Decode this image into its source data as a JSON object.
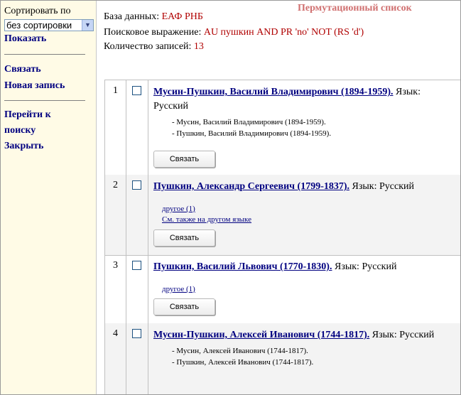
{
  "sidebar": {
    "sort_label": "Сортировать по",
    "sort_selected": "без сортировки",
    "show": "Показать",
    "link": "Связать",
    "new_record": "Новая запись",
    "goto_search_line1": "Перейти к",
    "goto_search_line2": "поиску",
    "close": "Закрыть"
  },
  "header": {
    "title": "Пермутационный список",
    "db_label": "База данных:",
    "db_value": "ЕАФ РНБ",
    "query_label": "Поисковое выражение:",
    "query_value": "AU пушкин AND PR 'no' NOT (RS 'd')",
    "count_label": "Количество записей:",
    "count_value": "13"
  },
  "records": [
    {
      "num": "1",
      "name": "Мусин-Пушкин, Василий Владимирович (1894-1959).",
      "lang": "Язык: Русский",
      "variants": [
        "- Мусин, Василий Владимирович (1894-1959).",
        "- Пушкин, Василий Владимирович (1894-1959)."
      ],
      "links": [],
      "button": "Связать"
    },
    {
      "num": "2",
      "name": "Пушкин, Александр Сергеевич (1799-1837).",
      "lang": "Язык: Русский",
      "variants": [],
      "links": [
        "другое (1)",
        "См. также на другом языке"
      ],
      "button": "Связать"
    },
    {
      "num": "3",
      "name": "Пушкин, Василий Львович (1770-1830).",
      "lang": "Язык: Русский",
      "variants": [],
      "links": [
        "другое (1)"
      ],
      "button": "Связать"
    },
    {
      "num": "4",
      "name": "Мусин-Пушкин, Алексей Иванович (1744-1817).",
      "lang": "Язык: Русский",
      "variants": [
        "- Мусин, Алексей Иванович (1744-1817).",
        "- Пушкин, Алексей Иванович (1744-1817)."
      ],
      "links": [],
      "button": null
    }
  ]
}
